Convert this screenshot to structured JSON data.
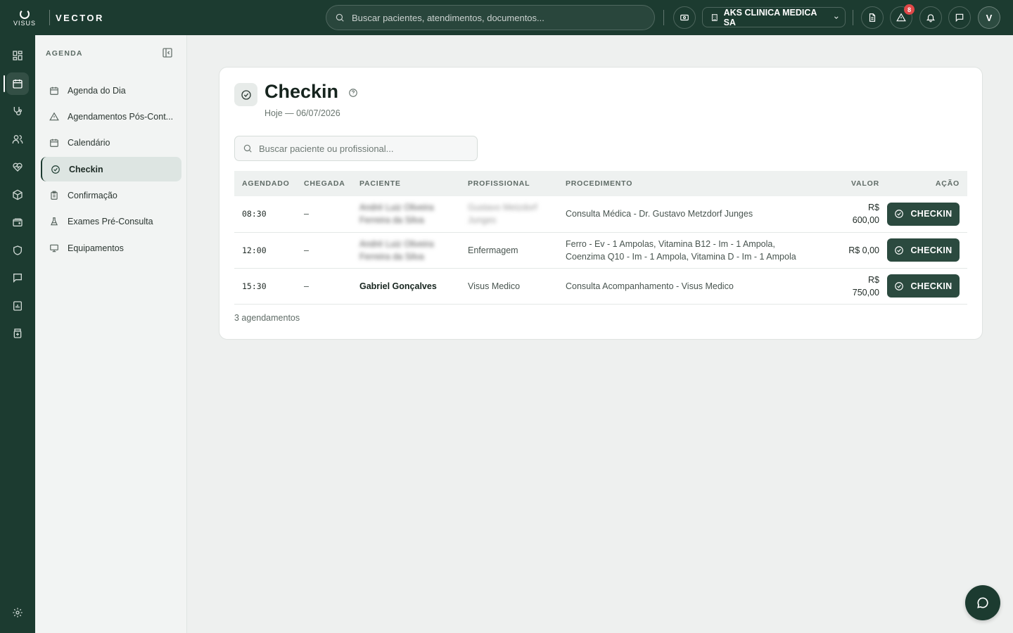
{
  "app": {
    "logo_text": "VISUS",
    "brand": "VECTOR"
  },
  "topbar": {
    "search_placeholder": "Buscar pacientes, atendimentos, documentos...",
    "clinic_name": "AKS CLINICA MEDICA SA",
    "alerts_count": "8",
    "user_initial": "V"
  },
  "sidebar": {
    "section_title": "AGENDA",
    "items": [
      {
        "label": "Agenda do Dia",
        "icon": "calendar-icon"
      },
      {
        "label": "Agendamentos Pós-Cont...",
        "icon": "warning-icon"
      },
      {
        "label": "Calendário",
        "icon": "calendar-icon"
      },
      {
        "label": "Checkin",
        "icon": "check-circle-icon",
        "active": true
      },
      {
        "label": "Confirmação",
        "icon": "clipboard-icon"
      },
      {
        "label": "Exames Pré-Consulta",
        "icon": "flask-icon"
      },
      {
        "label": "Equipamentos",
        "icon": "monitor-icon"
      }
    ]
  },
  "page": {
    "title": "Checkin",
    "subtitle": "Hoje — 06/07/2026",
    "search_placeholder": "Buscar paciente ou profissional...",
    "count_label": "3 agendamentos"
  },
  "table": {
    "headers": {
      "agendado": "AGENDADO",
      "chegada": "CHEGADA",
      "paciente": "PACIENTE",
      "profissional": "PROFISSIONAL",
      "procedimento": "PROCEDIMENTO",
      "valor": "VALOR",
      "acao": "AÇÃO"
    },
    "rows": [
      {
        "agendado": "08:30",
        "chegada": "–",
        "paciente": "André Luiz Oliveira Ferreira da Silva",
        "profissional": "Gustavo Metzdorf Junges",
        "procedimento": "Consulta Médica - Dr. Gustavo Metzdorf Junges",
        "valor_prefix": "R$",
        "valor_amount": "600,00",
        "action": "CHECKIN"
      },
      {
        "agendado": "12:00",
        "chegada": "–",
        "paciente": "André Luiz Oliveira Ferreira da Silva",
        "profissional": "Enfermagem",
        "procedimento_line1": "Ferro - Ev - 1 Ampolas, Vitamina B12 - Im - 1 Ampola,",
        "procedimento_line2": "Coenzima Q10 - Im - 1 Ampola, Vitamina D - Im - 1 Ampola",
        "valor": "R$ 0,00",
        "action": "CHECKIN"
      },
      {
        "agendado": "15:30",
        "chegada": "–",
        "paciente": "Gabriel Gonçalves",
        "profissional": "Visus Medico",
        "procedimento": "Consulta Acompanhamento - Visus Medico",
        "valor_prefix": "R$",
        "valor_amount": "750,00",
        "action": "CHECKIN"
      }
    ]
  },
  "colors": {
    "primary_dark": "#1c3b30",
    "button": "#2b4a3f",
    "badge": "#e04848"
  }
}
